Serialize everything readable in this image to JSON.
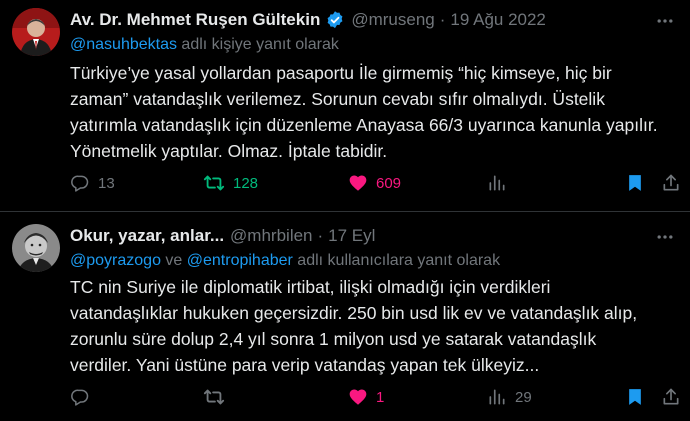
{
  "tweets": [
    {
      "author_name": "Av. Dr. Mehmet Ruşen Gültekin",
      "verified": true,
      "handle": "@mruseng",
      "separator": "·",
      "date": "19 Ağu 2022",
      "reply_mentions": [
        "@nasuhbektas"
      ],
      "reply_joiner": "",
      "reply_suffix": " adlı kişiye yanıt olarak",
      "body_lines": [
        "Türkiye’ye yasal yollardan pasaportu İle girmemiş “hiç kimseye, hiç bir",
        "zaman” vatandaşlık verilemez. Sorunun cevabı sıfır olmalıydı. Üstelik",
        "yatırımla vatandaşlık için düzenleme Anayasa 66/3 uyarınca kanunla yapılır.",
        "Yönetmelik yaptılar. Olmaz. İptale tabidir."
      ],
      "stats": {
        "replies": "13",
        "retweets": "128",
        "likes": "609",
        "views": ""
      },
      "retweeted": true,
      "liked": true,
      "bookmarked": true
    },
    {
      "author_name": "Okur, yazar, anlar...",
      "verified": false,
      "handle": "@mhrbilen",
      "separator": "·",
      "date": "17 Eyl",
      "reply_mentions": [
        "@poyrazogo",
        "@entropihaber"
      ],
      "reply_joiner": " ve ",
      "reply_suffix": " adlı kullanıcılara yanıt olarak",
      "body_lines": [
        "TC nin Suriye ile diplomatik irtibat, ilişki olmadığı için verdikleri",
        "vatandaşlıklar hukuken geçersizdir. 250 bin usd lik ev ve vatandaşlık alıp,",
        "zorunlu süre dolup 2,4  yıl sonra 1 milyon usd ye satarak vatandaşlık",
        "verdiler. Yani üstüne para verip vatandaş yapan tek ülkeyiz..."
      ],
      "stats": {
        "replies": "",
        "retweets": "",
        "likes": "1",
        "views": "29"
      },
      "retweeted": false,
      "liked": true,
      "bookmarked": true
    }
  ],
  "icons": {
    "more": "more-horizontal-icon",
    "reply": "reply-bubble-icon",
    "retweet": "retweet-icon",
    "like": "heart-icon",
    "views": "views-bar-chart-icon",
    "bookmark": "bookmark-icon",
    "share": "share-icon",
    "verified": "verified-badge-icon"
  },
  "colors": {
    "background": "#000000",
    "text": "#e7e9ea",
    "muted": "#71767b",
    "accent_blue": "#1d9bf0",
    "retweet_green": "#00ba7c",
    "like_pink": "#f91880",
    "divider": "#2f3336"
  }
}
